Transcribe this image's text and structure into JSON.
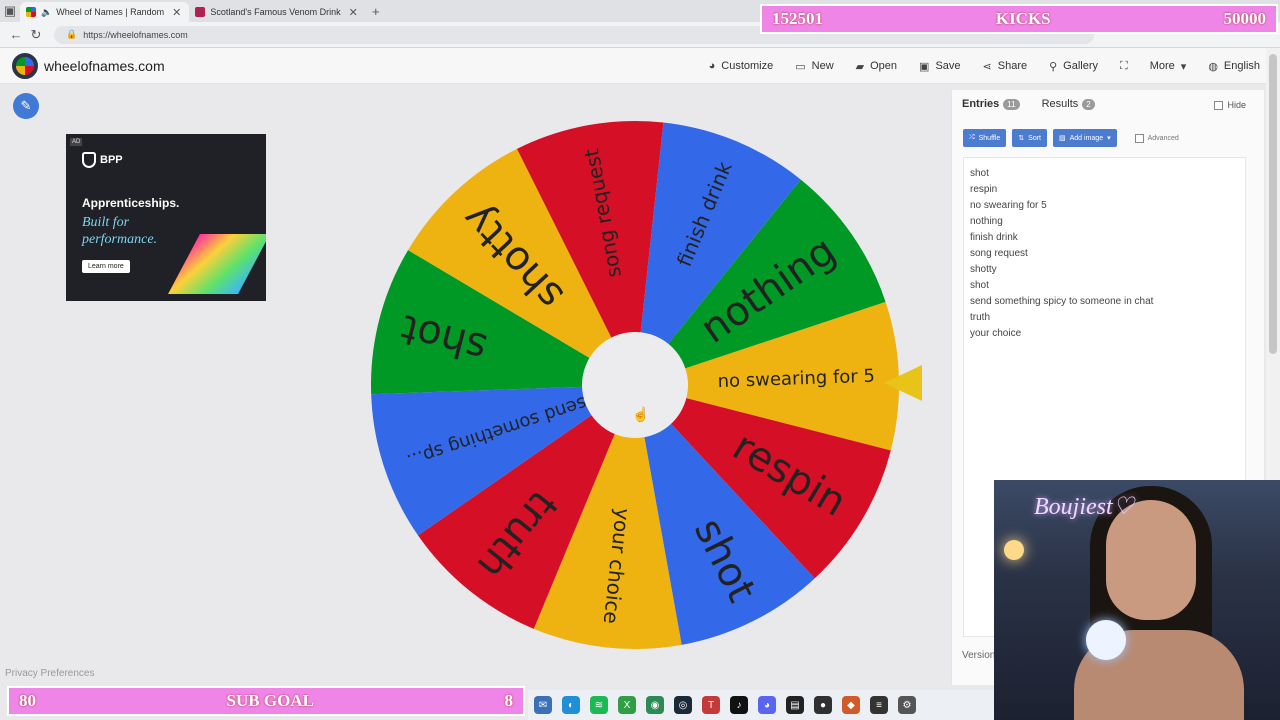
{
  "browser": {
    "tabs": [
      {
        "title": "Wheel of Names | Random",
        "active": true
      },
      {
        "title": "Scotland's Famous Venom Drink",
        "active": false
      }
    ],
    "url": "https://wheelofnames.com"
  },
  "app": {
    "brand": "wheelofnames.com",
    "menu": [
      {
        "label": "Customize",
        "icon": "palette-icon"
      },
      {
        "label": "New",
        "icon": "new-file-icon"
      },
      {
        "label": "Open",
        "icon": "folder-icon"
      },
      {
        "label": "Save",
        "icon": "save-icon"
      },
      {
        "label": "Share",
        "icon": "share-icon"
      },
      {
        "label": "Gallery",
        "icon": "search-icon"
      },
      {
        "label": "",
        "icon": "fullscreen-icon"
      },
      {
        "label": "More",
        "icon": "chevron-down-icon"
      },
      {
        "label": "English",
        "icon": "globe-icon"
      }
    ]
  },
  "ad": {
    "tag": "AD",
    "brand": "BPP",
    "headline": "Apprenticeships.",
    "tagline": "Built for performance.",
    "cta": "Learn more"
  },
  "wheel": {
    "slices": [
      {
        "label": "no swearing for 5",
        "color": "#eeb211"
      },
      {
        "label": "respin",
        "color": "#d50f25"
      },
      {
        "label": "shot",
        "color": "#3369e8"
      },
      {
        "label": "your choice",
        "color": "#eeb211"
      },
      {
        "label": "truth",
        "color": "#d50f25"
      },
      {
        "label": "send something sp...",
        "color": "#3369e8"
      },
      {
        "label": "shot",
        "color": "#009925"
      },
      {
        "label": "shotty",
        "color": "#eeb211"
      },
      {
        "label": "song request",
        "color": "#d50f25"
      },
      {
        "label": "finish drink",
        "color": "#3369e8"
      },
      {
        "label": "nothing",
        "color": "#009925"
      }
    ],
    "pointer_color": "#e8c418"
  },
  "privacy": "Privacy Preferences",
  "panel": {
    "entries_tab": "Entries",
    "entries_count": "11",
    "results_tab": "Results",
    "results_count": "2",
    "hide_label": "Hide",
    "shuffle": "Shuffle",
    "sort": "Sort",
    "add_image": "Add image",
    "advanced": "Advanced",
    "entries": [
      "shot",
      "respin",
      "no swearing for 5",
      "nothing",
      "finish drink",
      "song request",
      "shotty",
      "shot",
      "send something spicy to someone in chat",
      "truth",
      "your choice"
    ],
    "version": "Version"
  },
  "overlay": {
    "kicks_left": "152501",
    "kicks_title": "KICKS",
    "kicks_right": "50000",
    "sub_left": "80",
    "sub_title": "SUB GOAL",
    "sub_right": "8",
    "cam_sign": "Boujiest♡"
  }
}
